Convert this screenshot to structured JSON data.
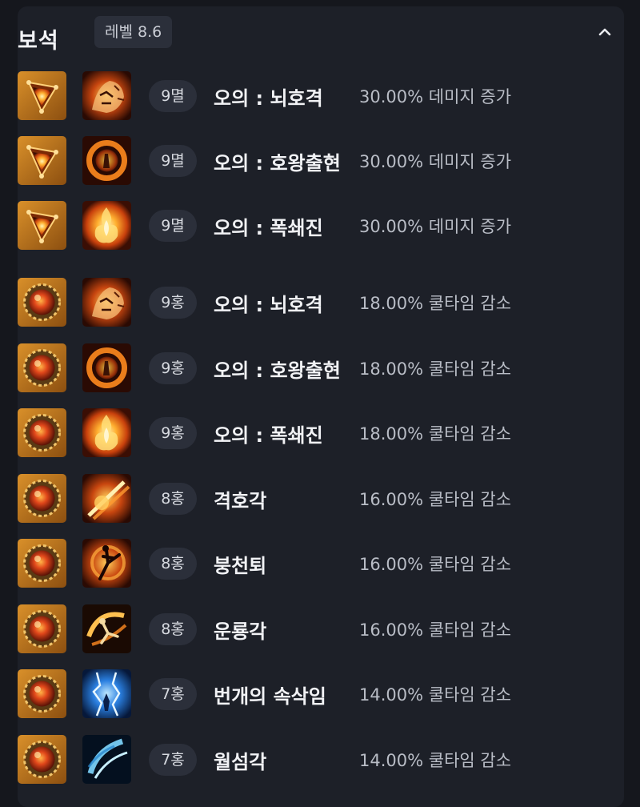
{
  "section": {
    "title": "보석",
    "level_label": "레벨 8.6",
    "collapse_icon": "chevron-up-icon"
  },
  "colors": {
    "panel_bg": "#1d2028",
    "page_bg": "#15171d",
    "badge_bg": "#2b2f3a",
    "damage_gem": "#c9781f",
    "cooldown_gem": "#d4561a"
  },
  "gems": [
    {
      "gem_type": "damage-gem",
      "skill_icon": "tiger-roar-icon",
      "level": "9멸",
      "skill": "오의 : 뇌호격",
      "effect": "30.00% 데미지 증가"
    },
    {
      "gem_type": "damage-gem",
      "skill_icon": "fire-swirl-icon",
      "level": "9멸",
      "skill": "오의 : 호왕출현",
      "effect": "30.00% 데미지 증가"
    },
    {
      "gem_type": "damage-gem",
      "skill_icon": "flame-burst-icon",
      "level": "9멸",
      "skill": "오의 : 폭쇄진",
      "effect": "30.00% 데미지 증가"
    },
    {
      "gem_type": "cooldown-gem",
      "skill_icon": "tiger-roar-icon",
      "level": "9홍",
      "skill": "오의 : 뇌호격",
      "effect": "18.00% 쿨타임 감소"
    },
    {
      "gem_type": "cooldown-gem",
      "skill_icon": "fire-swirl-icon",
      "level": "9홍",
      "skill": "오의 : 호왕출현",
      "effect": "18.00% 쿨타임 감소"
    },
    {
      "gem_type": "cooldown-gem",
      "skill_icon": "flame-burst-icon",
      "level": "9홍",
      "skill": "오의 : 폭쇄진",
      "effect": "18.00% 쿨타임 감소"
    },
    {
      "gem_type": "cooldown-gem",
      "skill_icon": "fire-strike-icon",
      "level": "8홍",
      "skill": "격호각",
      "effect": "16.00% 쿨타임 감소"
    },
    {
      "gem_type": "cooldown-gem",
      "skill_icon": "high-kick-icon",
      "level": "8홍",
      "skill": "붕천퇴",
      "effect": "16.00% 쿨타임 감소"
    },
    {
      "gem_type": "cooldown-gem",
      "skill_icon": "spin-kick-icon",
      "level": "8홍",
      "skill": "운룡각",
      "effect": "16.00% 쿨타임 감소"
    },
    {
      "gem_type": "cooldown-gem",
      "skill_icon": "lightning-icon",
      "level": "7홍",
      "skill": "번개의 속삭임",
      "effect": "14.00% 쿨타임 감소"
    },
    {
      "gem_type": "cooldown-gem",
      "skill_icon": "crescent-slash-icon",
      "level": "7홍",
      "skill": "월섬각",
      "effect": "14.00% 쿨타임 감소"
    }
  ]
}
